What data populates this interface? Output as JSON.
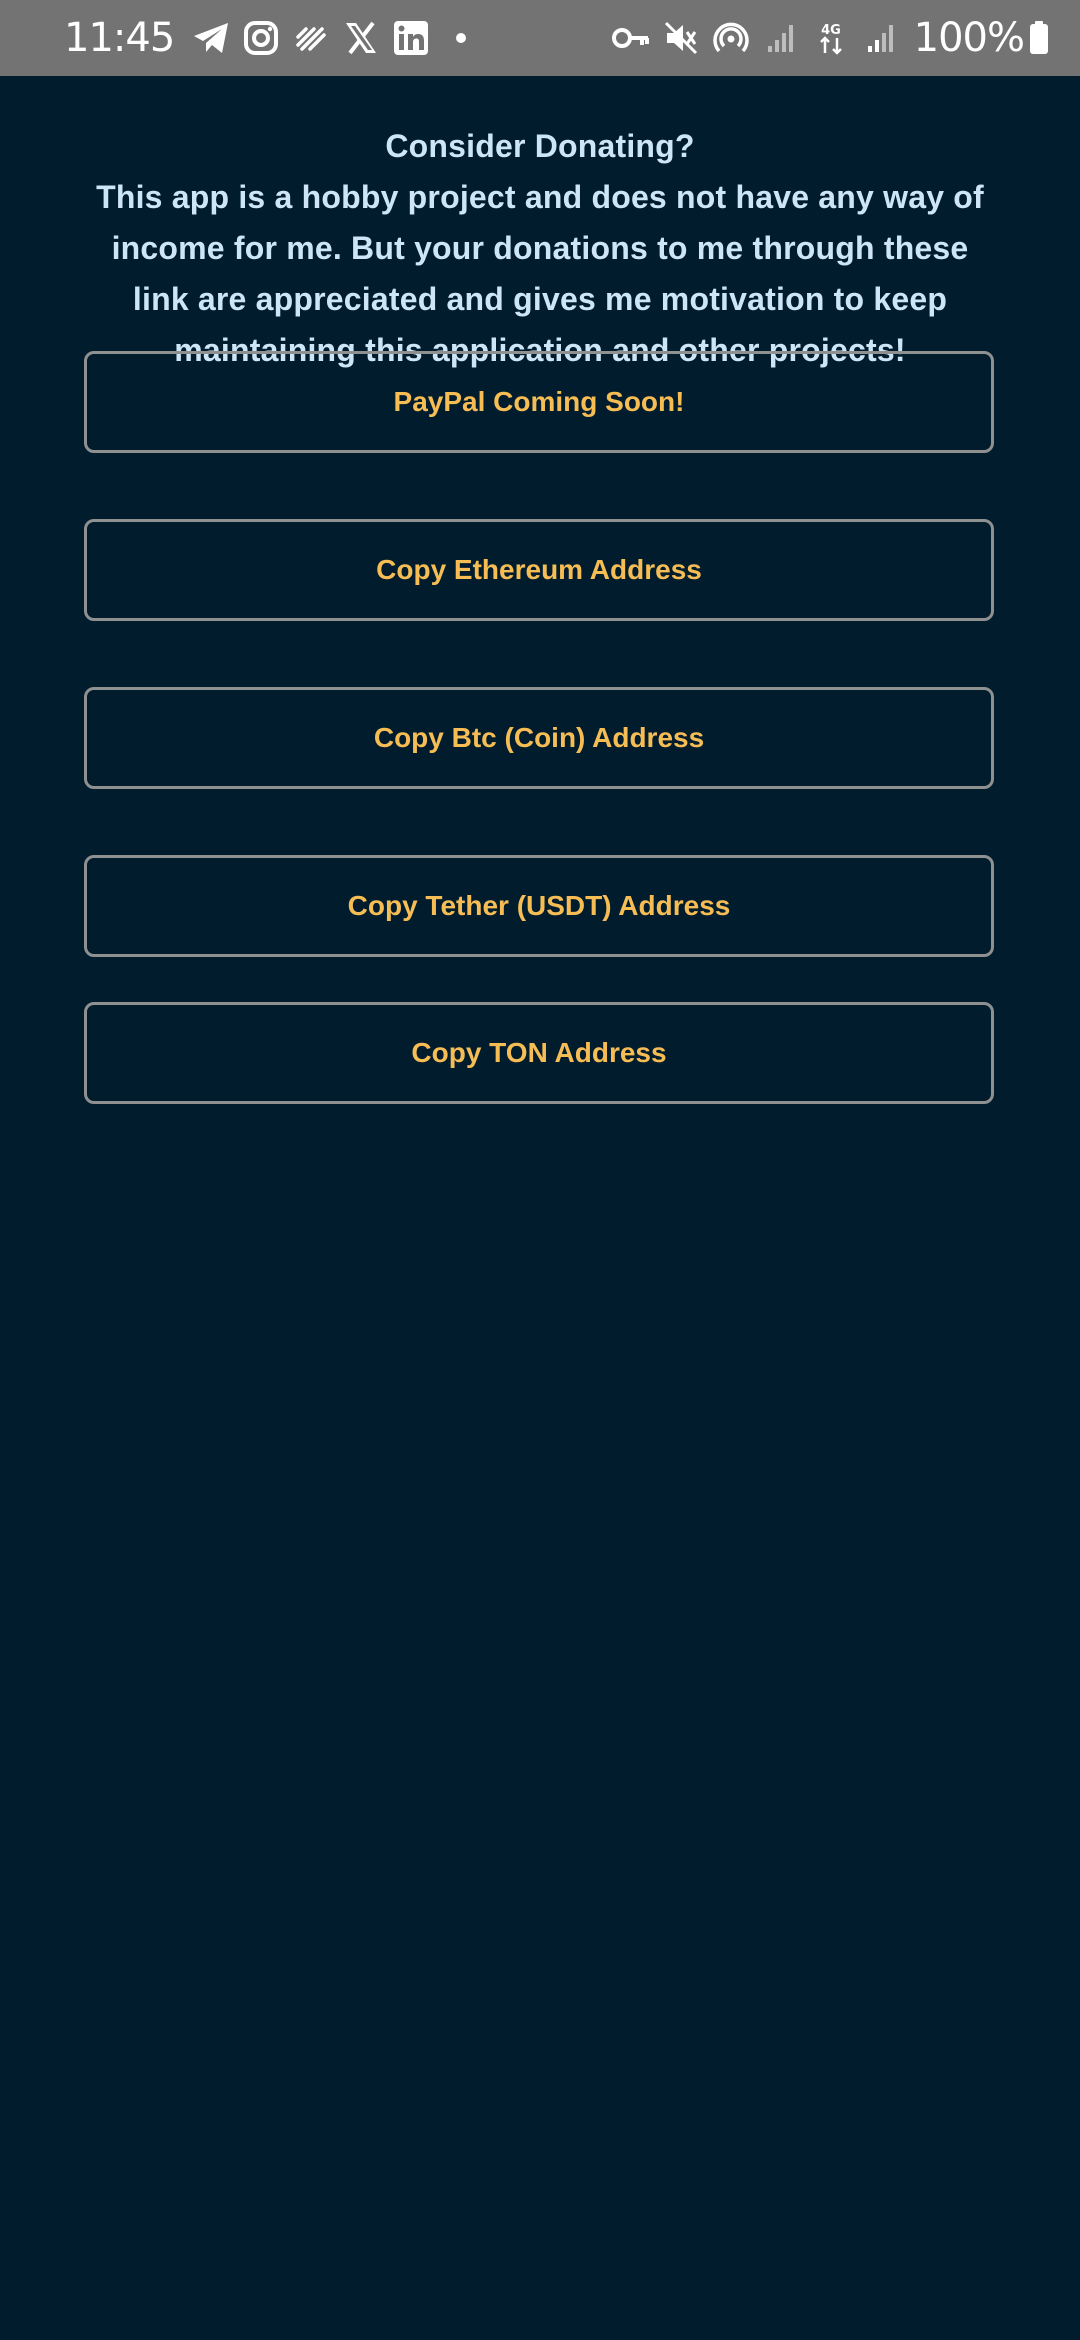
{
  "status_bar": {
    "time": "11:45",
    "battery_text": "100%",
    "left_icons": [
      "telegram-icon",
      "instagram-icon",
      "feed-icon",
      "x-icon",
      "linkedin-icon",
      "dot-icon"
    ],
    "right_icons": [
      "vpn-key-icon",
      "mute-icon",
      "hotspot-icon",
      "signal-icon",
      "data-4g-icon",
      "signal-icon",
      "battery-icon"
    ]
  },
  "donate": {
    "title": "Consider Donating?",
    "message_lines": [
      "This app is a hobby project and does not have any way of",
      "income for me. But your donations to me through these",
      "link are appreciated and gives me motivation to keep",
      "maintaining this application and other projects!"
    ]
  },
  "buttons": {
    "paypal": "PayPal Coming Soon!",
    "ethereum": "Copy Ethereum Address",
    "btc": "Copy Btc (Coin) Address",
    "usdt": "Copy Tether (USDT) Address",
    "ton": "Copy TON Address"
  },
  "colors": {
    "background": "#011c2d",
    "status_bar": "#737373",
    "heading_text": "#cde5f6",
    "button_text": "#f6bd55",
    "button_border": "#8f9090"
  }
}
